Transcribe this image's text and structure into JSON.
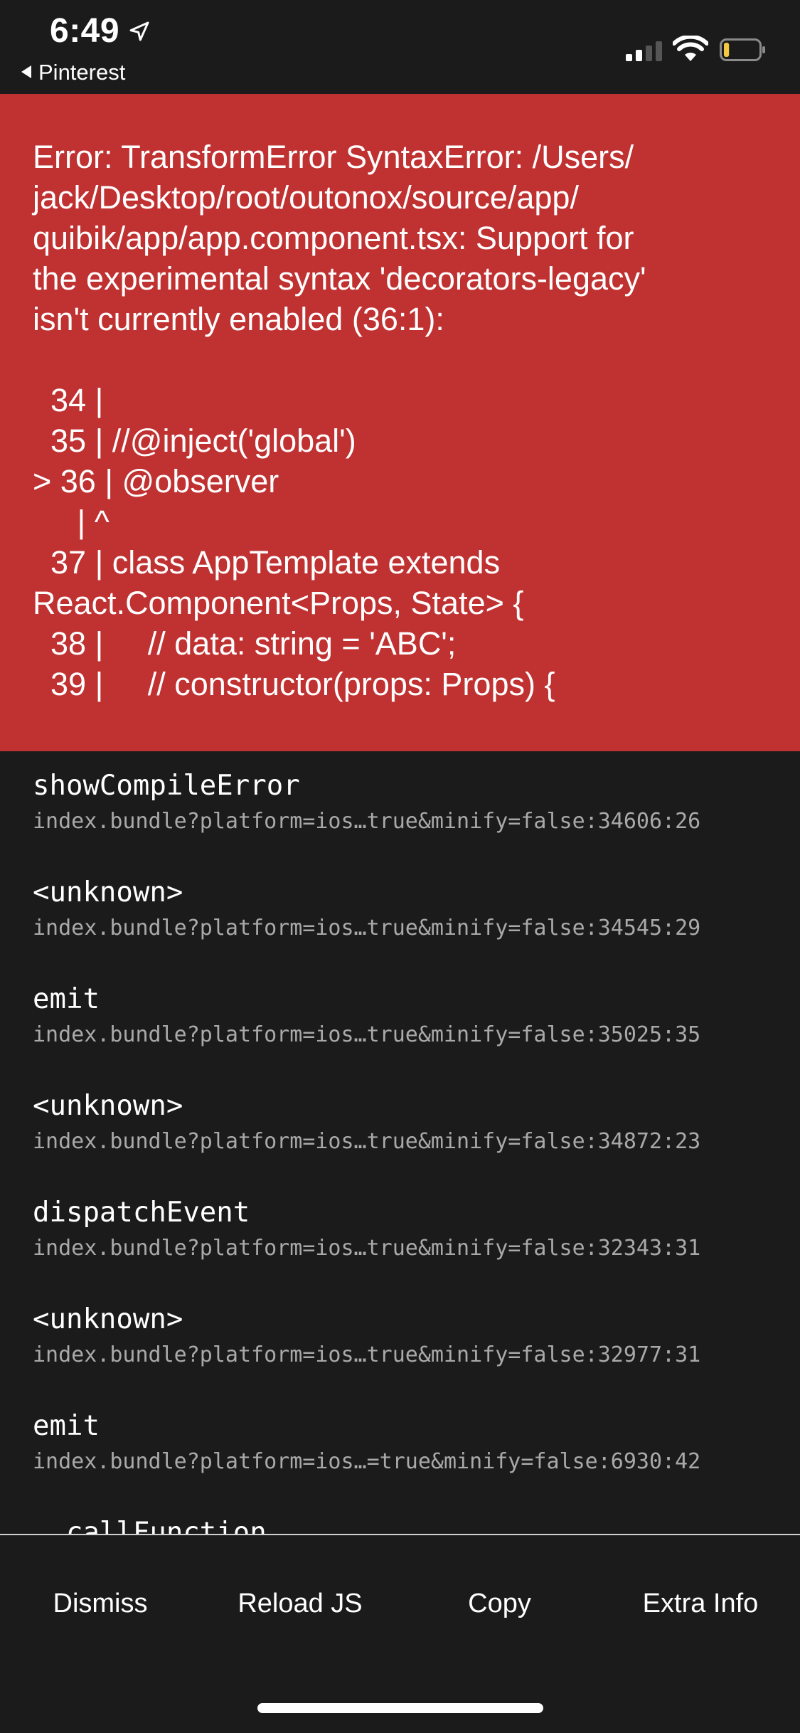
{
  "status_bar": {
    "time": "6:49",
    "back_app": "Pinterest",
    "icons": [
      "location-arrow-icon",
      "cellular-signal-icon",
      "wifi-icon",
      "battery-icon"
    ],
    "battery_fill": 0.15
  },
  "error": {
    "message": "Error: TransformError SyntaxError: /Users/\njack/Desktop/root/outonox/source/app/\nquibik/app/app.component.tsx: Support for\nthe experimental syntax 'decorators-legacy'\nisn't currently enabled (36:1):\n\n  34 |\n  35 | //@inject('global')\n> 36 | @observer\n     | ^\n  37 | class AppTemplate extends\nReact.Component<Props, State> {\n  38 |     // data: string = 'ABC';\n  39 |     // constructor(props: Props) {"
  },
  "stack": [
    {
      "fn": "showCompileError",
      "loc": "index.bundle?platform=ios…true&minify=false:34606:26"
    },
    {
      "fn": "<unknown>",
      "loc": "index.bundle?platform=ios…true&minify=false:34545:29"
    },
    {
      "fn": "emit",
      "loc": "index.bundle?platform=ios…true&minify=false:35025:35"
    },
    {
      "fn": "<unknown>",
      "loc": "index.bundle?platform=ios…true&minify=false:34872:23"
    },
    {
      "fn": "dispatchEvent",
      "loc": "index.bundle?platform=ios…true&minify=false:32343:31"
    },
    {
      "fn": "<unknown>",
      "loc": "index.bundle?platform=ios…true&minify=false:32977:31"
    },
    {
      "fn": "emit",
      "loc": "index.bundle?platform=ios…=true&minify=false:6930:42"
    },
    {
      "fn": "__callFunction",
      "loc": ""
    }
  ],
  "buttons": {
    "dismiss": "Dismiss",
    "reload": "Reload JS",
    "copy": "Copy",
    "extra": "Extra Info"
  },
  "colors": {
    "error_red": "#c03131",
    "background": "#1b1b1b",
    "battery_yellow": "#f5c842"
  }
}
